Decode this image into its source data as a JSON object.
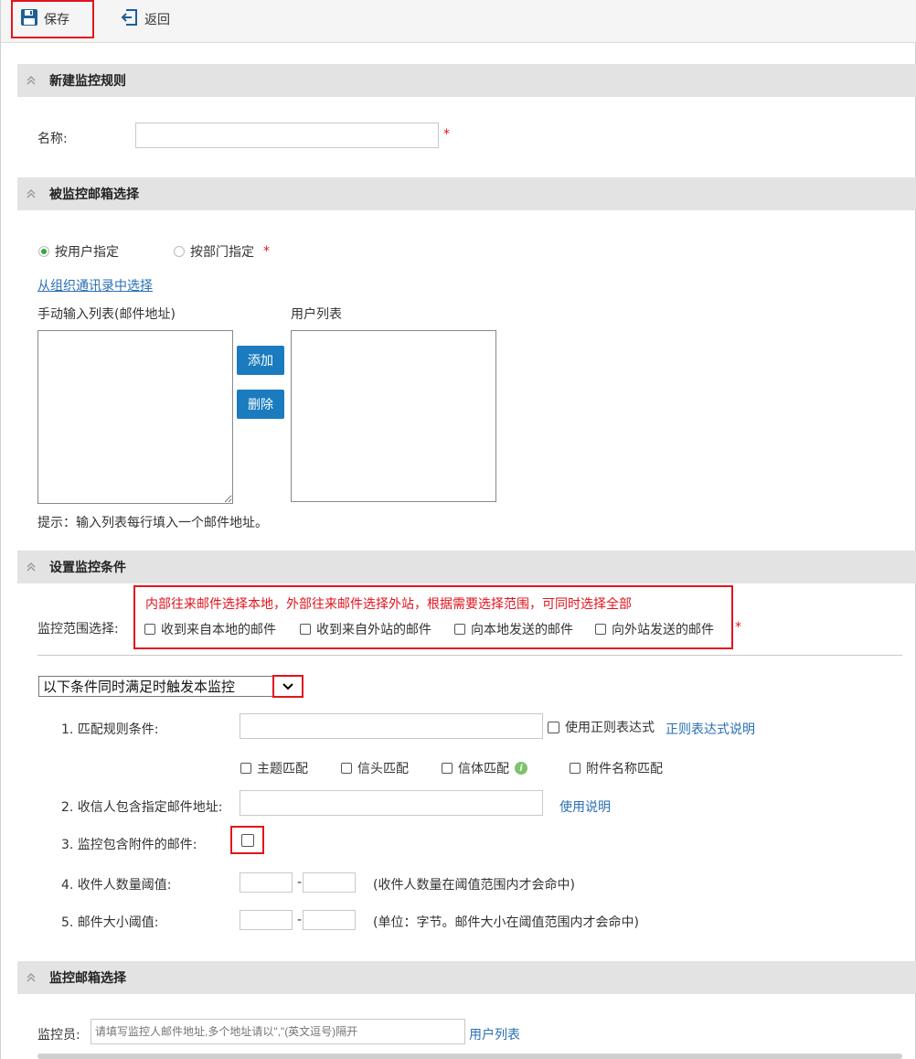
{
  "toolbar": {
    "save": "保存",
    "back": "返回"
  },
  "sections": {
    "new_rule": "新建监控规则",
    "mailbox_select": "被监控邮箱选择",
    "conditions": "设置监控条件",
    "monitor_mailbox": "监控邮箱选择"
  },
  "name_field": {
    "label": "名称:",
    "value": "",
    "required": "*"
  },
  "mailbox": {
    "radio_user": "按用户指定",
    "radio_dept": "按部门指定",
    "required": "*",
    "from_directory_link": "从组织通讯录中选择",
    "manual_list_label": "手动输入列表(邮件地址)",
    "user_list_label": "用户列表",
    "add_button": "添加",
    "delete_button": "删除",
    "hint": "提示：输入列表每行填入一个邮件地址。"
  },
  "scope": {
    "label": "监控范围选择:",
    "note": "内部往来邮件选择本地，外部往来邮件选择外站，根据需要选择范围，可同时选择全部",
    "options": [
      "收到来自本地的邮件",
      "收到来自外站的邮件",
      "向本地发送的邮件",
      "向外站发送的邮件"
    ],
    "required": "*"
  },
  "trigger_select": {
    "value": "以下条件同时满足时触发本监控"
  },
  "rules": {
    "r1_label": "1. 匹配规则条件:",
    "regex_label": "使用正则表达式",
    "regex_help": "正则表达式说明",
    "match_options": [
      "主题匹配",
      "信头匹配",
      "信体匹配",
      "附件名称匹配"
    ],
    "info_icon_text": "i",
    "r2_label": "2. 收信人包含指定邮件地址:",
    "r2_help": "使用说明",
    "r3_label": "3. 监控包含附件的邮件:",
    "r4_label": "4. 收件人数量阈值:",
    "r4_note": "(收件人数量在阈值范围内才会命中)",
    "r5_label": "5. 邮件大小阈值:",
    "r5_note": "(单位：字节。邮件大小在阈值范围内才会命中)",
    "dash": "-"
  },
  "monitor": {
    "label": "监控员:",
    "placeholder": "请填写监控人邮件地址,多个地址请以\",\"(英文逗号)隔开",
    "user_list_link": "用户列表"
  },
  "colors": {
    "accent": "#1a7bbf",
    "highlight": "#e1141e",
    "radio_on": "#2eaa3c",
    "link": "#2a6fb3"
  }
}
